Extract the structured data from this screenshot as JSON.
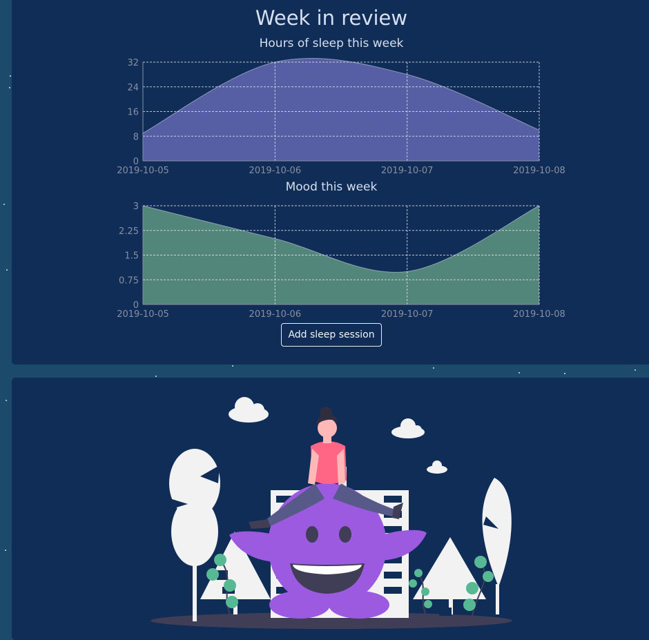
{
  "page": {
    "title": "Week in review",
    "add_button_label": "Add sleep session"
  },
  "colors": {
    "background": "#1b4a6b",
    "panel": "#102d58",
    "sleep_fill": "#5b62a8",
    "mood_fill": "#568b7c"
  },
  "chart_data": [
    {
      "type": "area",
      "title": "Hours of sleep this week",
      "x": [
        "2019-10-05",
        "2019-10-06",
        "2019-10-07",
        "2019-10-08"
      ],
      "values": [
        9,
        32,
        28,
        10
      ],
      "ylim": [
        0,
        32
      ],
      "yticks": [
        "0",
        "8",
        "16",
        "24",
        "32"
      ],
      "grid": true,
      "color": "#5b62a8"
    },
    {
      "type": "area",
      "title": "Mood this week",
      "x": [
        "2019-10-05",
        "2019-10-06",
        "2019-10-07",
        "2019-10-08"
      ],
      "values": [
        3,
        2,
        1,
        3
      ],
      "ylim": [
        0,
        3
      ],
      "yticks": [
        "0",
        "0.75",
        "1.5",
        "2.25",
        "3"
      ],
      "grid": true,
      "color": "#568b7c"
    }
  ],
  "illustration": {
    "subject": "person-sitting-on-purple-monster",
    "icons": [
      "cloud-icon",
      "tree-icon",
      "building-icon",
      "plant-icon"
    ]
  }
}
